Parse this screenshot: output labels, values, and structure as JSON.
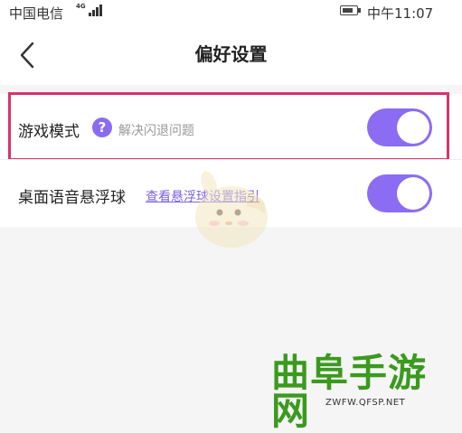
{
  "status_bar": {
    "carrier": "中国电信",
    "network": "4G",
    "time": "中午11:07"
  },
  "header": {
    "title": "偏好设置",
    "back_icon": "chevron-left-icon"
  },
  "settings": [
    {
      "label": "游戏模式",
      "help_icon": "question-icon",
      "help_glyph": "?",
      "hint": "解决闪退问题",
      "enabled": true
    },
    {
      "label": "桌面语音悬浮球",
      "link": "查看悬浮球设置指引",
      "enabled": true
    }
  ],
  "colors": {
    "accent": "#8b6cf3",
    "highlight_border": "#d8336e",
    "watermark": "#3a9a1e"
  },
  "watermark": {
    "text": "曲阜手游网",
    "url": "ZWFW.QFSP.NET"
  }
}
